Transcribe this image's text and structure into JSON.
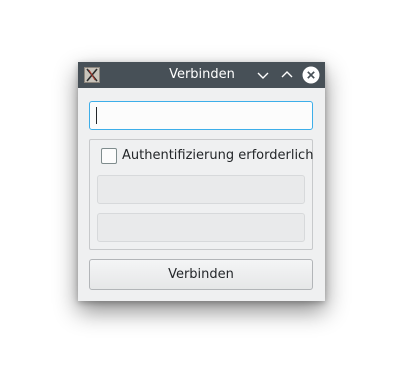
{
  "window": {
    "title": "Verbinden",
    "titlebar_color": "#475057",
    "close_button_color": "#ffffff"
  },
  "icons": {
    "app": "x11-app-icon",
    "minimize": "chevron-down-icon",
    "maximize": "chevron-up-icon",
    "close": "close-icon"
  },
  "form": {
    "host_value": "",
    "auth_checkbox_label": "Authentifizierung erforderlich",
    "auth_checked": false,
    "username_value": "",
    "password_value": "",
    "connect_button_label": "Verbinden"
  },
  "colors": {
    "focus_border": "#3daee9",
    "window_bg": "#eff0f1"
  }
}
